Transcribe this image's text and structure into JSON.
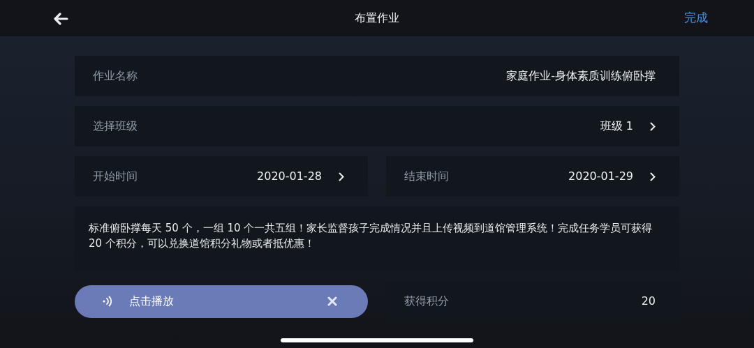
{
  "header": {
    "title": "布置作业",
    "action": "完成"
  },
  "homework_name": {
    "label": "作业名称",
    "value": "家庭作业-身体素质训练俯卧撑"
  },
  "class": {
    "label": "选择班级",
    "value": "班级 1"
  },
  "start_time": {
    "label": "开始时间",
    "value": "2020-01-28"
  },
  "end_time": {
    "label": "结束时间",
    "value": "2020-01-29"
  },
  "description": "标准俯卧撑每天 50 个，一组 10 个一共五组！家长监督孩子完成情况并且上传视频到道馆管理系统！完成任务学员可获得 20 个积分，可以兑换道馆积分礼物或者抵优惠！",
  "audio": {
    "label": "点击播放"
  },
  "points": {
    "label": "获得积分",
    "value": "20"
  }
}
